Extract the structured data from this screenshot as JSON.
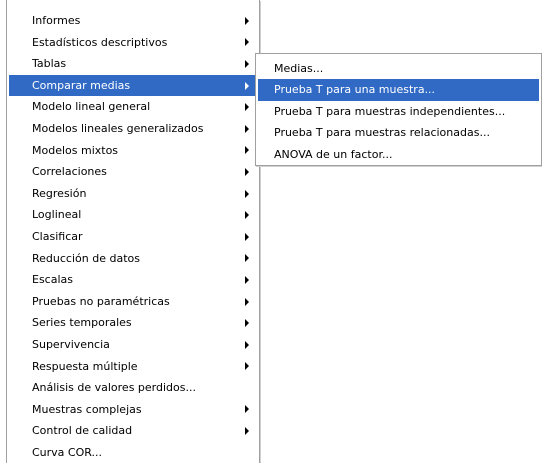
{
  "main_menu": {
    "items": [
      {
        "label": "Informes",
        "submenu": true
      },
      {
        "label": "Estadísticos descriptivos",
        "submenu": true
      },
      {
        "label": "Tablas",
        "submenu": true
      },
      {
        "label": "Comparar medias",
        "submenu": true,
        "selected": true
      },
      {
        "label": "Modelo lineal general",
        "submenu": true
      },
      {
        "label": "Modelos lineales generalizados",
        "submenu": true
      },
      {
        "label": "Modelos mixtos",
        "submenu": true
      },
      {
        "label": "Correlaciones",
        "submenu": true
      },
      {
        "label": "Regresión",
        "submenu": true
      },
      {
        "label": "Loglineal",
        "submenu": true
      },
      {
        "label": "Clasificar",
        "submenu": true
      },
      {
        "label": "Reducción de datos",
        "submenu": true
      },
      {
        "label": "Escalas",
        "submenu": true
      },
      {
        "label": "Pruebas no paramétricas",
        "submenu": true
      },
      {
        "label": "Series temporales",
        "submenu": true
      },
      {
        "label": "Supervivencia",
        "submenu": true
      },
      {
        "label": "Respuesta múltiple",
        "submenu": true
      },
      {
        "label": "Análisis de valores perdidos...",
        "submenu": false
      },
      {
        "label": "Muestras complejas",
        "submenu": true
      },
      {
        "label": "Control de calidad",
        "submenu": true
      },
      {
        "label": "Curva COR...",
        "submenu": false
      }
    ]
  },
  "sub_menu": {
    "items": [
      {
        "label": "Medias...",
        "selected": false
      },
      {
        "label": "Prueba T para una muestra...",
        "selected": true
      },
      {
        "label": "Prueba T para muestras independientes...",
        "selected": false
      },
      {
        "label": "Prueba T para muestras relacionadas...",
        "selected": false
      },
      {
        "label": "ANOVA de un factor...",
        "selected": false
      }
    ]
  },
  "colors": {
    "highlight": "#316ac5",
    "highlight_text": "#ffffff",
    "border": "#a0a0a0"
  }
}
